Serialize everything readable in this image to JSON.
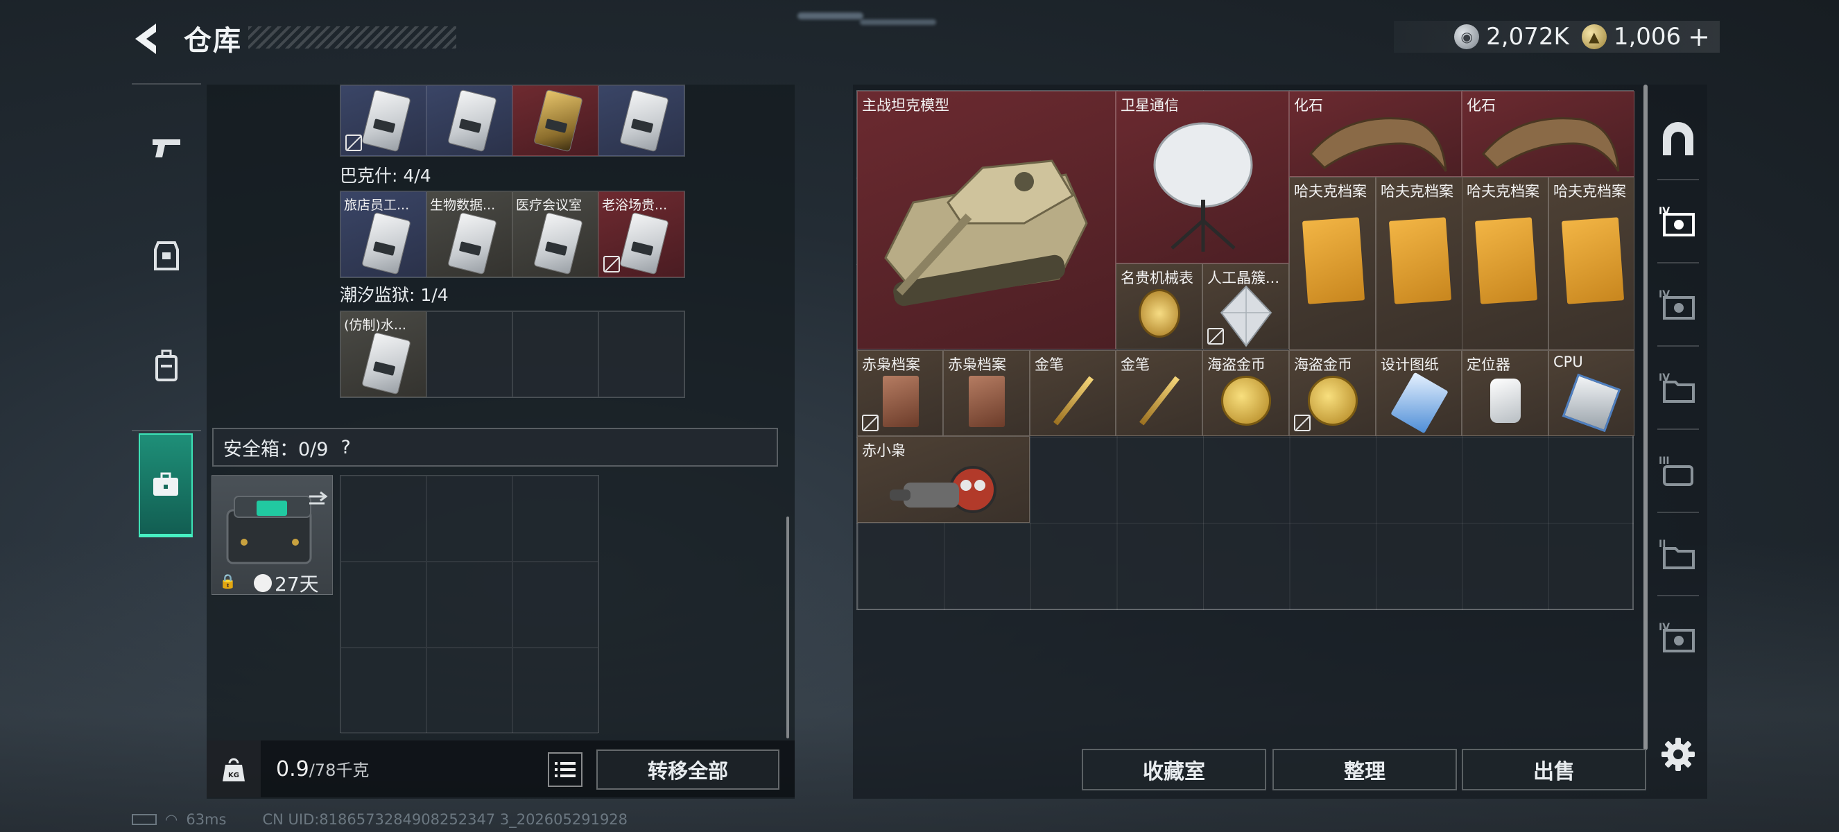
{
  "header": {
    "title": "仓库",
    "currencies": [
      {
        "icon": "silver-coin-icon",
        "value": "2,072K"
      },
      {
        "icon": "gold-coin-icon",
        "value": "1,006"
      }
    ],
    "add_symbol": "+"
  },
  "left": {
    "groups": [
      {
        "label": "巴克什: 4/4",
        "cells": [
          "旅店员工...",
          "生物数据...",
          "医疗会议室",
          "老浴场贵..."
        ]
      },
      {
        "label": "潮汐监狱: 1/4",
        "cells": [
          "(仿制)水..."
        ]
      }
    ],
    "safe": {
      "label": "安全箱：0/9",
      "help": "?",
      "days": "27天"
    },
    "weight": {
      "current": "0.9",
      "total": "/78千克"
    },
    "transfer_all": "转移全部"
  },
  "stash": {
    "items": [
      {
        "label": "主战坦克模型",
        "icon": "tank-model-icon"
      },
      {
        "label": "卫星通信",
        "icon": "satellite-dish-icon"
      },
      {
        "label": "化石",
        "icon": "fossil-claw-icon"
      },
      {
        "label": "化石",
        "icon": "fossil-claw-icon"
      },
      {
        "label": "哈夫克档案",
        "icon": "folder-icon"
      },
      {
        "label": "哈夫克档案",
        "icon": "folder-icon"
      },
      {
        "label": "哈夫克档案",
        "icon": "folder-icon"
      },
      {
        "label": "哈夫克档案",
        "icon": "folder-icon"
      },
      {
        "label": "名贵机械表",
        "icon": "watch-icon"
      },
      {
        "label": "人工晶簇...",
        "icon": "crystal-icon"
      },
      {
        "label": "赤枭档案",
        "icon": "document-icon"
      },
      {
        "label": "赤枭档案",
        "icon": "document-icon"
      },
      {
        "label": "金笔",
        "icon": "pen-icon"
      },
      {
        "label": "金笔",
        "icon": "pen-icon"
      },
      {
        "label": "海盗金币",
        "icon": "coin-icon"
      },
      {
        "label": "海盗金币",
        "icon": "coin-icon"
      },
      {
        "label": "设计图纸",
        "icon": "blueprint-icon"
      },
      {
        "label": "定位器",
        "icon": "tracker-icon"
      },
      {
        "label": "CPU",
        "icon": "cpu-icon"
      },
      {
        "label": "赤小枭",
        "icon": "figure-icon"
      }
    ],
    "buttons": {
      "collection": "收藏室",
      "organize": "整理",
      "sell": "出售"
    }
  },
  "status": {
    "ping": "63ms",
    "uid": "CN UID:8186573284908252347 3_202605291928"
  },
  "colors": {
    "accent": "#3de2b6",
    "rare_red": "#6b2a30",
    "text": "#e8ecef"
  }
}
